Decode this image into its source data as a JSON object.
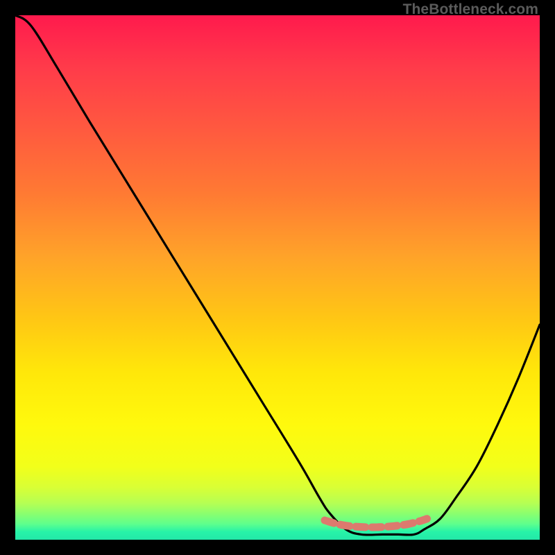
{
  "brand": "TheBottleneck.com",
  "chart_data": {
    "type": "line",
    "title": "",
    "xlabel": "",
    "ylabel": "",
    "xlim": [
      0,
      100
    ],
    "ylim": [
      0,
      100
    ],
    "series": [
      {
        "name": "bottleneck-curve",
        "x": [
          0,
          3,
          8,
          14,
          22,
          30,
          38,
          46,
          54,
          58,
          60,
          63,
          66,
          70,
          73,
          76,
          78,
          81,
          84,
          88,
          92,
          96,
          100
        ],
        "values": [
          100,
          98,
          90,
          80,
          67,
          54,
          41,
          28,
          15,
          8,
          5,
          2,
          1,
          1,
          1,
          1,
          2,
          4,
          8,
          14,
          22,
          31,
          41
        ]
      },
      {
        "name": "optimal-band",
        "x": [
          59,
          61,
          63,
          65,
          67,
          69,
          71,
          73,
          75,
          77,
          78.5
        ],
        "values": [
          3.7,
          3.1,
          2.7,
          2.5,
          2.4,
          2.4,
          2.5,
          2.7,
          3.0,
          3.5,
          4.0
        ]
      }
    ],
    "gradient_stops": [
      {
        "pos": 0,
        "color": "#ff1a4d"
      },
      {
        "pos": 0.22,
        "color": "#ff5a3f"
      },
      {
        "pos": 0.46,
        "color": "#ffa329"
      },
      {
        "pos": 0.68,
        "color": "#ffe70a"
      },
      {
        "pos": 0.9,
        "color": "#d9ff35"
      },
      {
        "pos": 1.0,
        "color": "#23e8a8"
      }
    ]
  }
}
